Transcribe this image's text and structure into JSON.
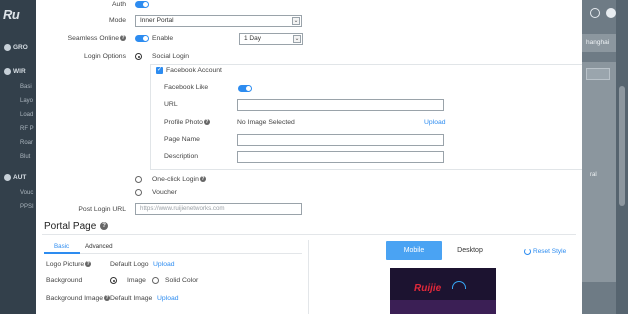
{
  "sidebar": {
    "logo": "Ru",
    "items": [
      {
        "label": "GRO",
        "type": "section"
      },
      {
        "label": "WIR",
        "type": "section"
      },
      {
        "label": "Basi",
        "type": "item"
      },
      {
        "label": "Layo",
        "type": "item"
      },
      {
        "label": "Load",
        "type": "item"
      },
      {
        "label": "RF P",
        "type": "item"
      },
      {
        "label": "Roar",
        "type": "item"
      },
      {
        "label": "Blut",
        "type": "item"
      },
      {
        "label": "AUT",
        "type": "section"
      },
      {
        "label": "Vouc",
        "type": "item"
      },
      {
        "label": "PPSI",
        "type": "item"
      }
    ]
  },
  "background_right": {
    "tag": "hanghai",
    "text1": "ral"
  },
  "form": {
    "auth_label": "Auth",
    "mode_label": "Mode",
    "mode_value": "Inner Portal",
    "seamless_label": "Seamless Online",
    "seamless_enable": "Enable",
    "seamless_period": "1 Day",
    "login_options_label": "Login Options",
    "social_login": "Social Login",
    "facebook_account": "Facebook Account",
    "facebook_like": "Facebook Like",
    "url_label": "URL",
    "profile_photo_label": "Profile Photo",
    "no_image": "No Image Selected",
    "upload": "Upload",
    "page_name_label": "Page Name",
    "description_label": "Description",
    "one_click_login": "One-click Login",
    "voucher": "Voucher",
    "post_login_url_label": "Post Login URL",
    "post_login_url_placeholder": "https://www.ruijienetworks.com"
  },
  "portal_page": {
    "title": "Portal Page",
    "tabs": [
      {
        "label": "Basic",
        "active": true
      },
      {
        "label": "Advanced",
        "active": false
      }
    ],
    "logo_picture_label": "Logo Picture",
    "default_logo": "Default Logo",
    "upload": "Upload",
    "background_label": "Background",
    "bg_image": "Image",
    "bg_solid": "Solid Color",
    "background_image_label": "Background Image",
    "default_image": "Default Image",
    "mobile": "Mobile",
    "desktop": "Desktop",
    "reset_style": "Reset Style",
    "preview_brand": "Ruijie"
  },
  "colors": {
    "accent": "#2d8cf0",
    "sidebar": "#33404b",
    "overlay": "#5a6a77"
  }
}
